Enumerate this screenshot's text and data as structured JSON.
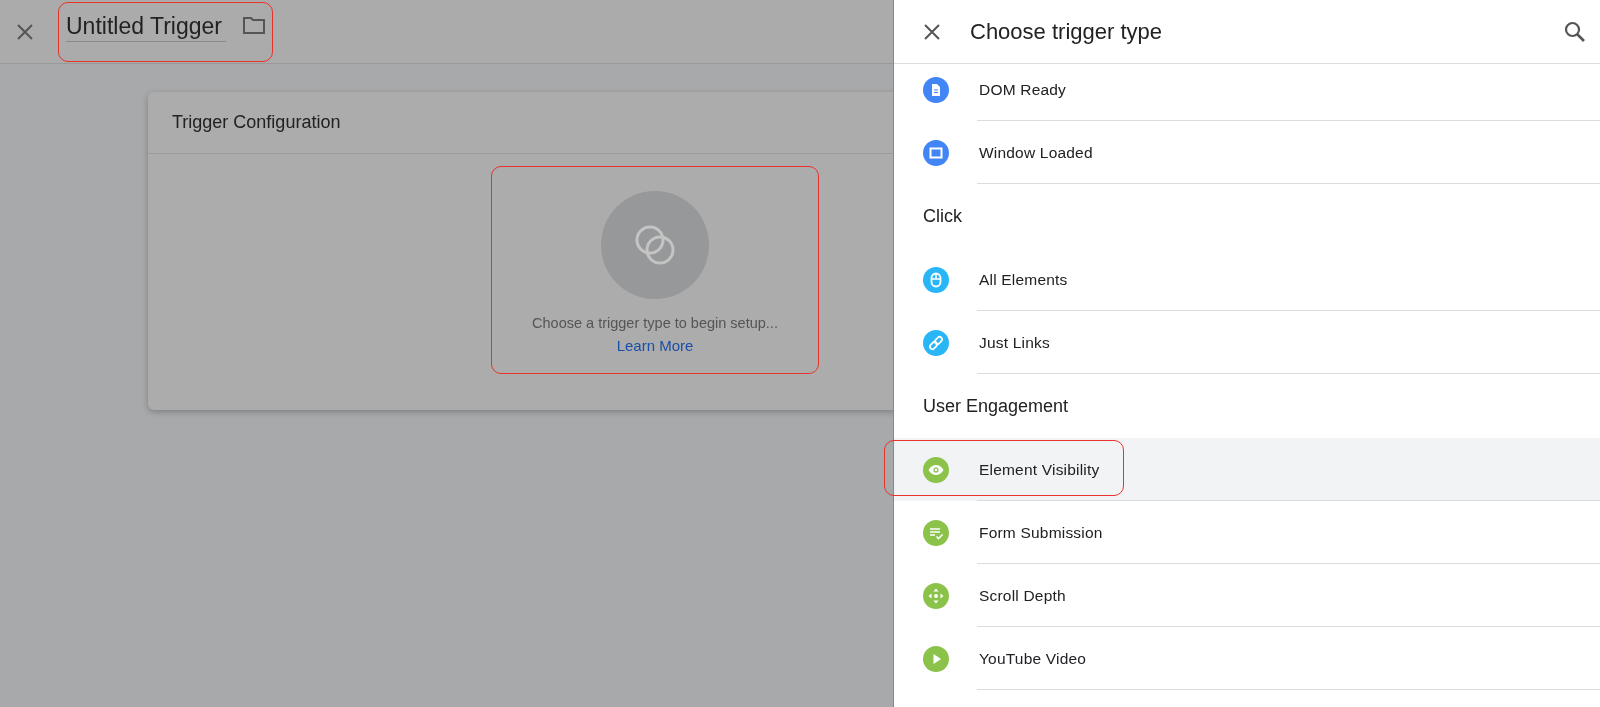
{
  "editor": {
    "name": "Untitled Trigger",
    "name_highlighted": true,
    "card": {
      "title": "Trigger Configuration",
      "empty_state": {
        "message": "Choose a trigger type to begin setup...",
        "link": "Learn More",
        "highlighted": true
      }
    }
  },
  "panel": {
    "title": "Choose trigger type",
    "sections": [
      {
        "items": [
          {
            "label": "DOM Ready",
            "color": "#4285f4",
            "selected": false,
            "highlighted": false
          },
          {
            "label": "Window Loaded",
            "color": "#4285f4",
            "selected": false,
            "highlighted": false
          }
        ]
      },
      {
        "heading": "Click",
        "items": [
          {
            "label": "All Elements",
            "color": "#29b6f6",
            "selected": false,
            "highlighted": false
          },
          {
            "label": "Just Links",
            "color": "#29b6f6",
            "selected": false,
            "highlighted": false
          }
        ]
      },
      {
        "heading": "User Engagement",
        "items": [
          {
            "label": "Element Visibility",
            "color": "#8bc34a",
            "selected": true,
            "highlighted": true
          },
          {
            "label": "Form Submission",
            "color": "#8bc34a",
            "selected": false,
            "highlighted": false
          },
          {
            "label": "Scroll Depth",
            "color": "#8bc34a",
            "selected": false,
            "highlighted": false
          },
          {
            "label": "YouTube Video",
            "color": "#8bc34a",
            "selected": false,
            "highlighted": false
          }
        ]
      }
    ]
  }
}
